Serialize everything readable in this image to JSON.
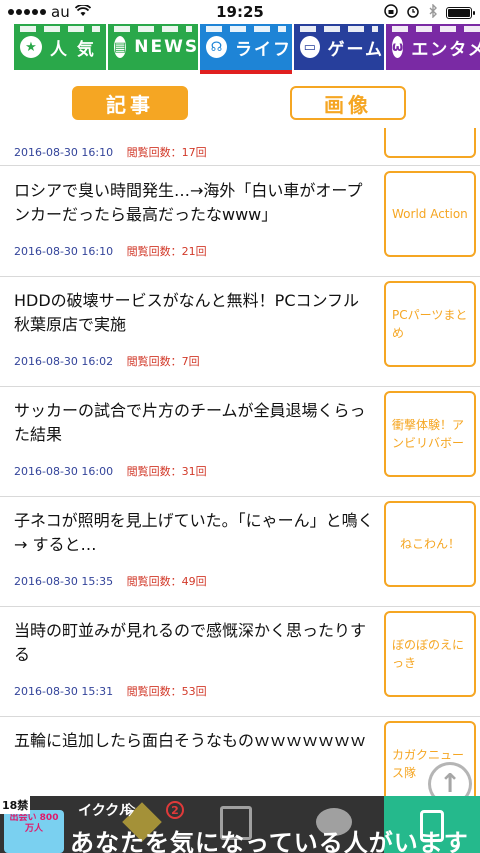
{
  "status_bar": {
    "carrier": "au",
    "time": "19:25"
  },
  "tabs": [
    {
      "label": "人 気",
      "color": "#2aa84a",
      "icon": "star-icon",
      "glyph": "★"
    },
    {
      "label": "NEWS",
      "color": "#2aa84a",
      "icon": "newspaper-icon",
      "glyph": "▤"
    },
    {
      "label": "ライフ",
      "color": "#1e84d6",
      "icon": "headphones-icon",
      "glyph": "☊",
      "active": true
    },
    {
      "label": "ゲーム",
      "color": "#273f9c",
      "icon": "tv-icon",
      "glyph": "▭"
    },
    {
      "label": "エンタメ",
      "color": "#7a2aa4",
      "icon": "smile-icon",
      "glyph": "ω"
    }
  ],
  "switch": {
    "articles": "記事",
    "images": "画像"
  },
  "partial_item": {
    "date": "2016-08-30 16:10",
    "views": "閲覧回数：17回"
  },
  "articles": [
    {
      "title": "ロシアで臭い時間発生…→海外「白い車がオープンカーだったら最高だったなwww」",
      "date": "2016-08-30 16:10",
      "views": "閲覧回数：21回",
      "source": "World Action"
    },
    {
      "title": "HDDの破壊サービスがなんと無料！PCコンフル 秋葉原店で実施",
      "date": "2016-08-30 16:02",
      "views": "閲覧回数：7回",
      "source": "PCパーツまとめ"
    },
    {
      "title": "サッカーの試合で片方のチームが全員退場くらった結果",
      "date": "2016-08-30 16:00",
      "views": "閲覧回数：31回",
      "source": "衝撃体験！アンビリバボー"
    },
    {
      "title": "子ネコが照明を見上げていた。「にゃーん」と鳴く → すると…",
      "date": "2016-08-30 15:35",
      "views": "閲覧回数：49回",
      "source": "ねこわん！"
    },
    {
      "title": "当時の町並みが見れるので感慨深かく思ったりする",
      "date": "2016-08-30 15:31",
      "views": "閲覧回数：53回",
      "source": "ぼのぼのえにっき"
    },
    {
      "title": "五輪に追加したら面白そうなものｗｗｗｗｗｗｗ",
      "date": "",
      "views": "",
      "source": "カガクニュース隊"
    }
  ],
  "ad": {
    "badge": "18禁",
    "image_text": "出会い 800 万人",
    "brand": "イククル",
    "now": "今",
    "count": "2",
    "message": "あなたを気になっている人がいます"
  }
}
